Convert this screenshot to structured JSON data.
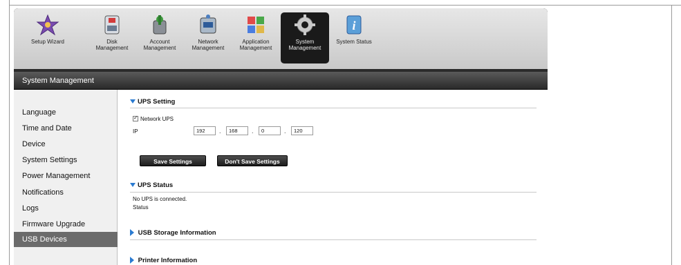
{
  "nav": {
    "items": [
      {
        "label": "Setup Wizard",
        "label2": ""
      },
      {
        "label": "Disk",
        "label2": "Management"
      },
      {
        "label": "Account",
        "label2": "Management"
      },
      {
        "label": "Network",
        "label2": "Management"
      },
      {
        "label": "Application",
        "label2": "Management"
      },
      {
        "label": "System",
        "label2": "Management"
      },
      {
        "label": "System Status",
        "label2": ""
      }
    ],
    "active_index": 5
  },
  "section_header": "System Management",
  "sidebar": {
    "items": [
      {
        "label": "Language"
      },
      {
        "label": "Time and Date"
      },
      {
        "label": "Device"
      },
      {
        "label": "System Settings"
      },
      {
        "label": "Power Management"
      },
      {
        "label": "Notifications"
      },
      {
        "label": "Logs"
      },
      {
        "label": "Firmware Upgrade"
      },
      {
        "label": "USB Devices"
      }
    ],
    "active": "USB Devices"
  },
  "ups_setting": {
    "title": "UPS Setting",
    "network_ups_label": "Network UPS",
    "network_ups_checked": true,
    "ip_label": "IP",
    "ip": [
      "192",
      "168",
      "0",
      "120"
    ],
    "save_button": "Save Settings",
    "dont_save_button": "Don't Save Settings"
  },
  "ups_status": {
    "title": "UPS Status",
    "message": "No UPS is connected.",
    "status_label": "Status"
  },
  "usb_storage": {
    "title": "USB Storage Information"
  },
  "printer": {
    "title": "Printer Information"
  },
  "colors": {
    "accent": "#2b7bd1",
    "active_tab": "#1a1a1a",
    "sidebar_active": "#6b6b6b"
  }
}
